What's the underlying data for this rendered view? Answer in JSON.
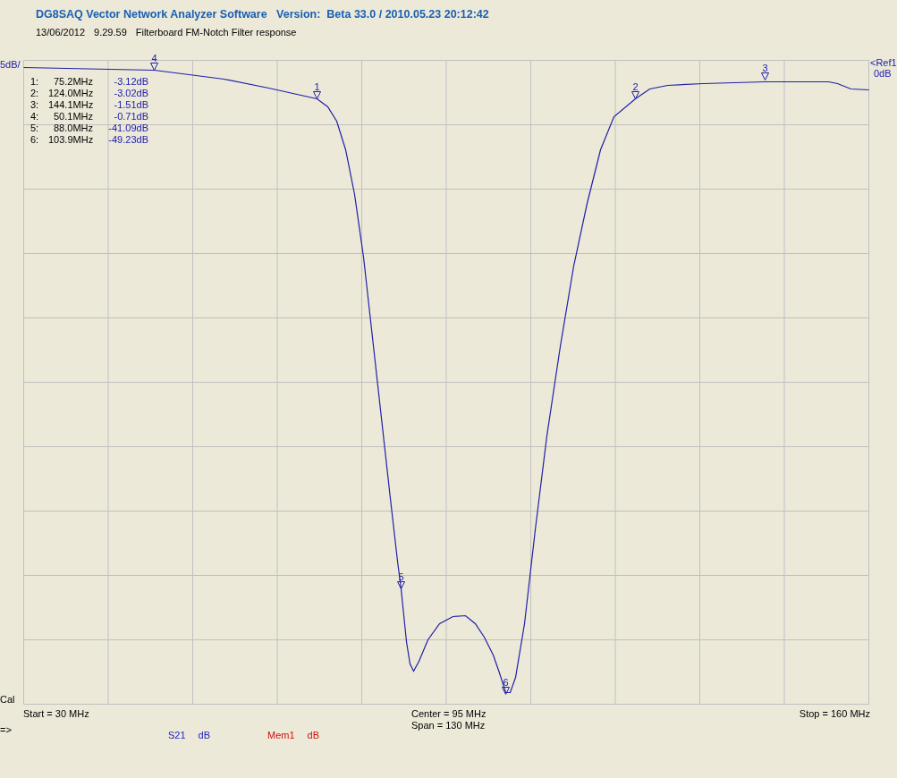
{
  "header": {
    "title": "DG8SAQ Vector Network Analyzer Software   Version:  Beta 33.0 / 2010.05.23 20:12:42",
    "date": "13/06/2012",
    "time": "9.29.59",
    "description": "Filterboard FM-Notch Filter response"
  },
  "chart": {
    "scale_label": "5dB/",
    "ref_label": "<Ref1",
    "ref_value": "0dB",
    "cal_label": "Cal",
    "markers": [
      {
        "number": "1:",
        "frequency": "75.2MHz",
        "value": "-3.12dB"
      },
      {
        "number": "2:",
        "frequency": "124.0MHz",
        "value": "-3.02dB"
      },
      {
        "number": "3:",
        "frequency": "144.1MHz",
        "value": "-1.51dB"
      },
      {
        "number": "4:",
        "frequency": "50.1MHz",
        "value": "-0.71dB"
      },
      {
        "number": "5:",
        "frequency": "88.0MHz",
        "value": "-41.09dB"
      },
      {
        "number": "6:",
        "frequency": "103.9MHz",
        "value": "-49.23dB"
      }
    ],
    "trace_markers": [
      {
        "label": "1"
      },
      {
        "label": "2"
      },
      {
        "label": "3"
      },
      {
        "label": "4"
      },
      {
        "label": "5"
      },
      {
        "label": "6"
      }
    ]
  },
  "footer": {
    "start": "Start = 30 MHz",
    "center": "Center = 95 MHz",
    "span": "Span = 130 MHz",
    "stop": "Stop = 160 MHz"
  },
  "status": {
    "prompt": "=>",
    "traces": [
      {
        "name": "S21",
        "unit": "dB",
        "color": "#2020c0"
      },
      {
        "name": "Mem1",
        "unit": "dB",
        "color": "#d01010"
      }
    ]
  }
}
